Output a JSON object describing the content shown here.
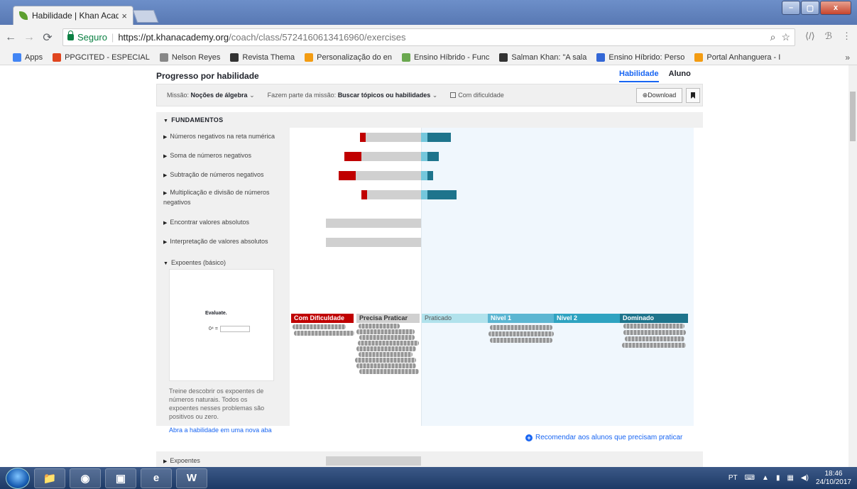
{
  "browser": {
    "tab_title": "Habilidade | Khan Acade",
    "tab_close": "×",
    "secure_label": "Seguro",
    "url_separator": "|",
    "url_host": "https://pt.khanacademy.org",
    "url_path": "/coach/class/5724160613416960/exercises",
    "window_controls": [
      "–",
      "▢",
      "x"
    ]
  },
  "bookmarks": [
    {
      "label": "Apps",
      "icon": "apps-grid-icon",
      "color": "#4285f4"
    },
    {
      "label": "PPGCITED - ESPECIAL",
      "icon": "x-logo-icon",
      "color": "#e0451f"
    },
    {
      "label": "Nelson Reyes",
      "icon": "page-icon",
      "color": "#888888"
    },
    {
      "label": "Revista Thema",
      "icon": "pkp-logo-icon",
      "color": "#333333"
    },
    {
      "label": "Personalização do en",
      "icon": "orange-logo-icon",
      "color": "#f39c12"
    },
    {
      "label": "Ensino Híbrido - Func",
      "icon": "leaf-icon",
      "color": "#6aa84f"
    },
    {
      "label": "Salman Khan: \"A sala",
      "icon": "e-logo-icon",
      "color": "#333333"
    },
    {
      "label": "Ensino Híbrido: Perso",
      "icon": "infinity-icon",
      "color": "#3367d6"
    },
    {
      "label": "Portal Anhanguera - I",
      "icon": "triangle-logo-icon",
      "color": "#f39c12"
    }
  ],
  "bookmarks_overflow": "»",
  "page": {
    "title": "Progresso por habilidade",
    "view_tabs": [
      {
        "label": "Habilidade",
        "active": true
      },
      {
        "label": "Aluno",
        "active": false
      }
    ],
    "filters": {
      "mission_label": "Missão:",
      "mission_value": "Noções de álgebra",
      "part_label": "Fazem parte da missão:",
      "part_value": "Buscar tópicos ou habilidades",
      "struggling_label": "Com dificuldade",
      "download_label": "⊕Download"
    },
    "section_title": "FUNDAMENTOS",
    "skills": [
      {
        "label": "Números negativos na reta numérica",
        "red": 8,
        "grey": 78,
        "teal": 42
      },
      {
        "label": "Soma de números negativos",
        "red": 24,
        "grey": 84,
        "teal": 25
      },
      {
        "label": "Subtração de números negativos",
        "red": 24,
        "grey": 92,
        "teal": 17
      },
      {
        "label": "Multiplicação e divisão de números negativos",
        "red": 8,
        "grey": 76,
        "teal": 50
      },
      {
        "label": "Encontrar valores absolutos",
        "red": 0,
        "grey": 134,
        "teal": 0
      },
      {
        "label": "Interpretação de valores absolutos",
        "red": 0,
        "grey": 134,
        "teal": 0
      }
    ],
    "expanded_skill": {
      "label": "Expoentes (básico)",
      "preview_title": "Evaluate.",
      "preview_expr": "0⁴ =",
      "description": "Treine descobrir os expoentes de números naturais. Todos os expoentes nesses problemas são positivos ou zero.",
      "link": "Abra a habilidade em uma nova aba"
    },
    "legend": [
      "Com Dificuldade",
      "Precisa Praticar",
      "Praticado",
      "Nível 1",
      "Nível 2",
      "Dominado"
    ],
    "legend_colors": [
      "#c00000",
      "#d0d0d0",
      "#b1e2ec",
      "#5cb6d2",
      "#2fa3c1",
      "#1e748c"
    ],
    "recommend_label": "Recomendar aos alunos que precisam praticar",
    "next_skill": "Expoentes"
  },
  "taskbar": {
    "apps": [
      "folder-icon",
      "chrome-icon",
      "media-icon",
      "ie-icon",
      "word-icon"
    ],
    "word_label": "W",
    "ie_label": "e",
    "language": "PT",
    "time": "18:46",
    "date": "24/10/2017"
  }
}
